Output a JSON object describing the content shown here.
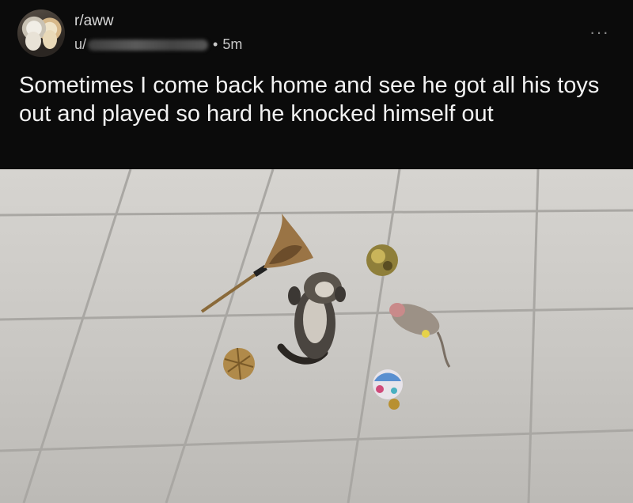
{
  "post": {
    "subreddit": "r/aww",
    "author_prefix": "u/",
    "separator": "•",
    "age": "5m",
    "title": "Sometimes I come back home and see he got all his toys out and played so hard he knocked himself out",
    "more_label": "···"
  },
  "icons": {
    "more": "ellipsis-icon",
    "avatar": "chicks-avatar"
  }
}
